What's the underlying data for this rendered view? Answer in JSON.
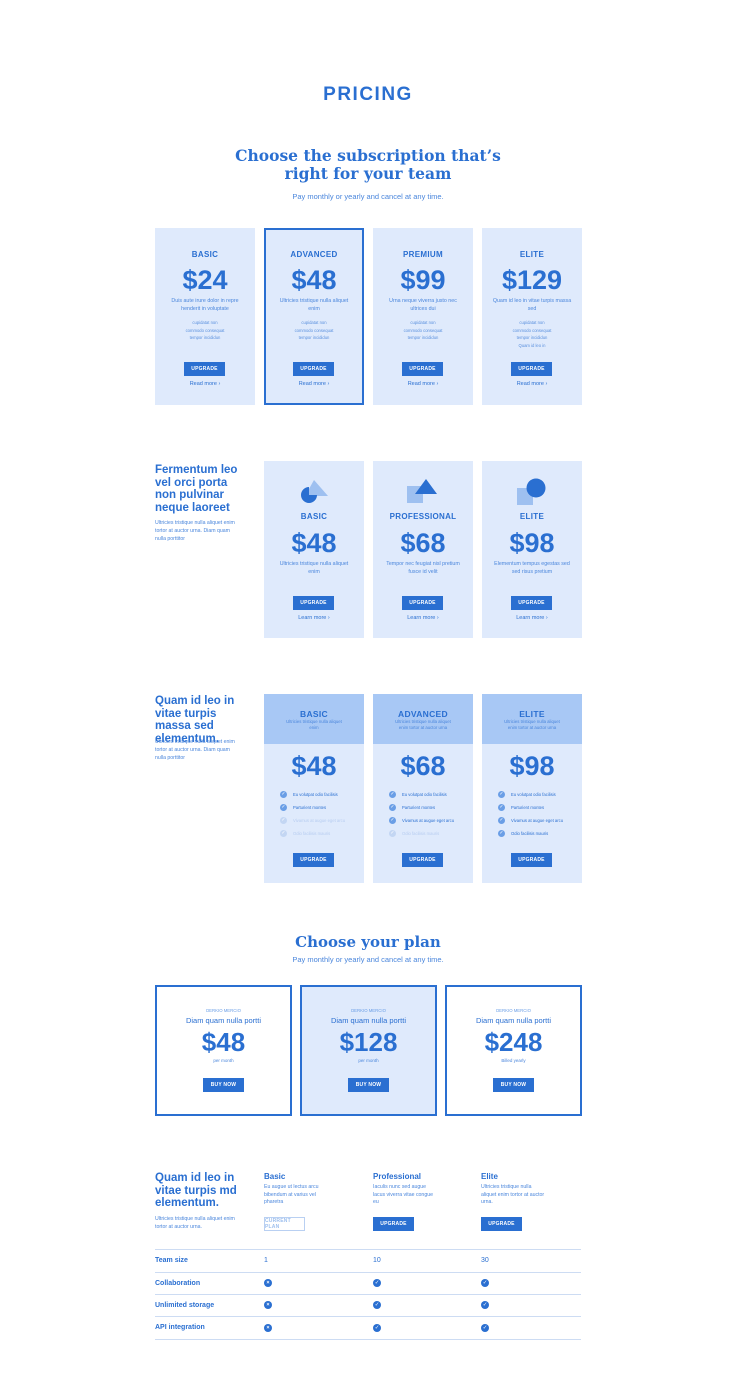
{
  "header": {
    "title": "PRICING"
  },
  "hero": {
    "heading_line1": "Choose the subscription that’s",
    "heading_line2": "right for your team",
    "subtitle": "Pay monthly or yearly and cancel at any time."
  },
  "section1": {
    "cards": [
      {
        "tier": "BASIC",
        "price": "$24",
        "desc": "Duis aute irure dolor in repre henderit in voluptate",
        "features": [
          "cupidatat non",
          "commodo consequat",
          "tempor incididun"
        ],
        "button": "UPGRADE",
        "link": "Read more"
      },
      {
        "tier": "ADVANCED",
        "price": "$48",
        "desc": "Ultricies tristique nulla aliquet enim",
        "features": [
          "cupidatat non",
          "commodo consequat",
          "tempor incididun"
        ],
        "button": "UPGRADE",
        "link": "Read more"
      },
      {
        "tier": "PREMIUM",
        "price": "$99",
        "desc": "Urna neque viverra justo nec ultrices dui",
        "features": [
          "cupidatat non",
          "commodo consequat",
          "tempor incididun"
        ],
        "button": "UPGRADE",
        "link": "Read more"
      },
      {
        "tier": "ELITE",
        "price": "$129",
        "desc": "Quam id leo in vitae turpis massa sed",
        "features": [
          "cupidatat non",
          "commodo consequat",
          "tempor incididun",
          "Quam id leo in"
        ],
        "button": "UPGRADE",
        "link": "Read more"
      }
    ]
  },
  "section2": {
    "title": "Fermentum leo vel orci porta non pulvinar neque laoreet",
    "desc": "Ultricies tristique nulla aliquet enim tortor at auctor urna. Diam quam nulla porttitor",
    "cards": [
      {
        "icon": "pie-triangle-icon",
        "tier": "BASIC",
        "price": "$48",
        "desc": "Ultricies tristique nulla aliquet enim",
        "button": "UPGRADE",
        "link": "Learn more"
      },
      {
        "icon": "square-triangle-icon",
        "tier": "PROFESSIONAL",
        "price": "$68",
        "desc": "Tempor nec feugiat nisl pretium fusce id velit",
        "button": "UPGRADE",
        "link": "Learn more"
      },
      {
        "icon": "square-circle-icon",
        "tier": "ELITE",
        "price": "$98",
        "desc": "Elementum tempus egestas sed sed risus pretium",
        "button": "UPGRADE",
        "link": "Learn more"
      }
    ]
  },
  "section3": {
    "title": "Quam id leo in vitae turpis massa sed elementum.",
    "desc": "Ultricies tristique nulla aliquet enim tortor at auctor urna. Diam quam nulla porttitor",
    "cards": [
      {
        "tier": "BASIC",
        "sub": "Ultricies tristique nulla aliquet enim",
        "price": "$48",
        "features": [
          {
            "t": "Eu volutpat odio facilisis",
            "on": true
          },
          {
            "t": "Parturient montes",
            "on": true
          },
          {
            "t": "Vivamus at augue eget arcu",
            "on": false
          },
          {
            "t": "Odio facilisis mauris",
            "on": false
          }
        ],
        "button": "UPGRADE"
      },
      {
        "tier": "ADVANCED",
        "sub": "Ultricies tristique nulla aliquet enim tortor at auctor urna",
        "price": "$68",
        "features": [
          {
            "t": "Eu volutpat odio facilisis",
            "on": true
          },
          {
            "t": "Parturient montes",
            "on": true
          },
          {
            "t": "Vivamus at augue eget arcu",
            "on": true
          },
          {
            "t": "Odio facilisis mauris",
            "on": false
          }
        ],
        "button": "UPGRADE"
      },
      {
        "tier": "ELITE",
        "sub": "Ultricies tristique nulla aliquet enim tortor at auctor urna",
        "price": "$98",
        "features": [
          {
            "t": "Eu volutpat odio facilisis",
            "on": true
          },
          {
            "t": "Parturient montes",
            "on": true
          },
          {
            "t": "Vivamus at augue eget arcu",
            "on": true
          },
          {
            "t": "Odio facilisis mauris",
            "on": true
          }
        ],
        "button": "UPGRADE"
      }
    ]
  },
  "section4": {
    "title": "Choose your plan",
    "subtitle": "Pay monthly or yearly and cancel at any time.",
    "plans": [
      {
        "eyebrow": "DERKIO MERCIO",
        "name": "Diam quam nulla portti",
        "price": "$48",
        "period": "per month",
        "button": "BUY NOW"
      },
      {
        "eyebrow": "DERKIO MERCIO",
        "name": "Diam quam nulla portti",
        "price": "$128",
        "period": "per month",
        "button": "BUY NOW"
      },
      {
        "eyebrow": "DERKIO MERCIO",
        "name": "Diam quam nulla portti",
        "price": "$248",
        "period": "Billed yearly",
        "button": "BUY NOW"
      }
    ]
  },
  "section5": {
    "title": "Quam id leo in vitae turpis md elementum.",
    "desc": "Ultricies tristique nulla aliquet enim tortor at auctor urna.",
    "plans": [
      {
        "name": "Basic",
        "desc": "Eu augue ut lectus arcu bibendum at varius vel pharetra",
        "button": "CURRENT PLAN"
      },
      {
        "name": "Professional",
        "desc": "Iaculis nunc sed augue lacus viverra vitae congue eu",
        "button": "UPGRADE"
      },
      {
        "name": "Elite",
        "desc": "Ultricies tristique nulla aliquet enim tortor at auctor urna.",
        "button": "UPGRADE"
      }
    ],
    "rows": [
      {
        "label": "Team size",
        "values": [
          "1",
          "10",
          "30"
        ]
      },
      {
        "label": "Collaboration",
        "values": [
          "x",
          "check",
          "check"
        ]
      },
      {
        "label": "Unlimited storage",
        "values": [
          "x",
          "check",
          "check"
        ]
      },
      {
        "label": "API integration",
        "values": [
          "x",
          "check",
          "check"
        ]
      }
    ]
  }
}
